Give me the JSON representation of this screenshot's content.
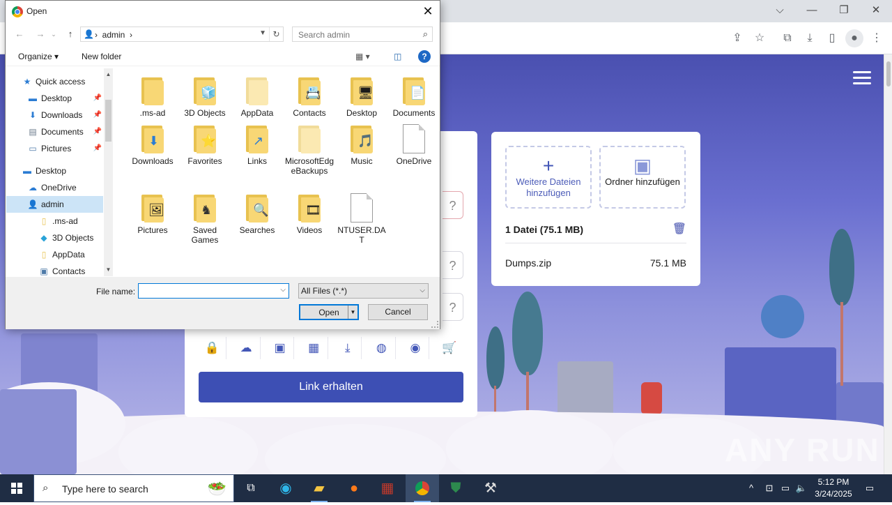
{
  "browser": {
    "window_controls": {
      "chevron": "⌵",
      "minimize": "—",
      "restore": "❐",
      "close": "✕"
    },
    "toolbar_icons": [
      "share-icon",
      "star-icon",
      "extensions-icon",
      "download-icon",
      "sidepanel-icon",
      "profile-icon",
      "menu-icon"
    ]
  },
  "page": {
    "upload_card": {
      "link_button": "Link erhalten",
      "qmarks": [
        "?",
        "?",
        "?"
      ],
      "icons": [
        "lock-icon",
        "cloud-icon",
        "image-icon",
        "calendar-icon",
        "download-icon",
        "globe-icon",
        "eye-icon",
        "cart-icon"
      ]
    },
    "files_card": {
      "add_files_label": "Weitere Dateien hinzufügen",
      "add_folder_label": "Ordner hinzufügen",
      "summary": "1 Datei (75.1 MB)",
      "files": [
        {
          "name": "Dumps.zip",
          "size": "75.1 MB"
        }
      ]
    },
    "watermark": "ANY RUN"
  },
  "dialog": {
    "title": "Open",
    "close": "✕",
    "address": {
      "crumb_sep": "›",
      "location": "admin",
      "crumb_end": "›"
    },
    "search_placeholder": "Search admin",
    "commands": {
      "organize": "Organize ▾",
      "new_folder": "New folder",
      "help": "?"
    },
    "nav_items": [
      {
        "label": "Quick access",
        "icon": "★",
        "indent": 0,
        "pinned": false
      },
      {
        "label": "Desktop",
        "icon": "▬",
        "indent": 1,
        "pinned": true
      },
      {
        "label": "Downloads",
        "icon": "⬇",
        "indent": 1,
        "pinned": true
      },
      {
        "label": "Documents",
        "icon": "▤",
        "indent": 1,
        "pinned": true
      },
      {
        "label": "Pictures",
        "icon": "▭",
        "indent": 1,
        "pinned": true
      },
      {
        "label": "Desktop",
        "icon": "▬",
        "indent": 0,
        "pinned": false
      },
      {
        "label": "OneDrive",
        "icon": "☁",
        "indent": 1,
        "pinned": false
      },
      {
        "label": "admin",
        "icon": "👤",
        "indent": 1,
        "pinned": false
      },
      {
        "label": ".ms-ad",
        "icon": "▯",
        "indent": 2,
        "pinned": false
      },
      {
        "label": "3D Objects",
        "icon": "◆",
        "indent": 2,
        "pinned": false
      },
      {
        "label": "AppData",
        "icon": "▯",
        "indent": 2,
        "pinned": false
      },
      {
        "label": "Contacts",
        "icon": "▣",
        "indent": 2,
        "pinned": false
      }
    ],
    "files": [
      {
        "label": ".ms-ad",
        "type": "folder",
        "badge": ""
      },
      {
        "label": "3D Objects",
        "type": "folder",
        "badge": "🧊"
      },
      {
        "label": "AppData",
        "type": "folder",
        "badge": ""
      },
      {
        "label": "Contacts",
        "type": "folder",
        "badge": "📇"
      },
      {
        "label": "Desktop",
        "type": "folder",
        "badge": "🖥"
      },
      {
        "label": "Documents",
        "type": "folder",
        "badge": "📄"
      },
      {
        "label": "Downloads",
        "type": "folder",
        "badge": "⬇"
      },
      {
        "label": "Favorites",
        "type": "folder",
        "badge": "⭐"
      },
      {
        "label": "Links",
        "type": "folder",
        "badge": "↗"
      },
      {
        "label": "MicrosoftEdgeBackups",
        "type": "folder",
        "badge": ""
      },
      {
        "label": "Music",
        "type": "folder",
        "badge": "🎵"
      },
      {
        "label": "OneDrive",
        "type": "file",
        "badge": ""
      },
      {
        "label": "Pictures",
        "type": "folder",
        "badge": "🖼"
      },
      {
        "label": "Saved Games",
        "type": "folder",
        "badge": "♞"
      },
      {
        "label": "Searches",
        "type": "folder",
        "badge": "🔍"
      },
      {
        "label": "Videos",
        "type": "folder",
        "badge": "🎞"
      },
      {
        "label": "NTUSER.DAT",
        "type": "file",
        "badge": ""
      }
    ],
    "file_name_label": "File name:",
    "file_name_value": "",
    "filter": "All Files (*.*)",
    "open_button": "Open",
    "cancel_button": "Cancel"
  },
  "taskbar": {
    "search_placeholder": "Type here to search",
    "time": "5:12 PM",
    "date": "3/24/2025",
    "apps": [
      "task-view-icon",
      "edge-icon",
      "file-explorer-icon",
      "firefox-icon",
      "winrar-icon",
      "chrome-icon",
      "shield-icon",
      "tools-icon"
    ]
  }
}
